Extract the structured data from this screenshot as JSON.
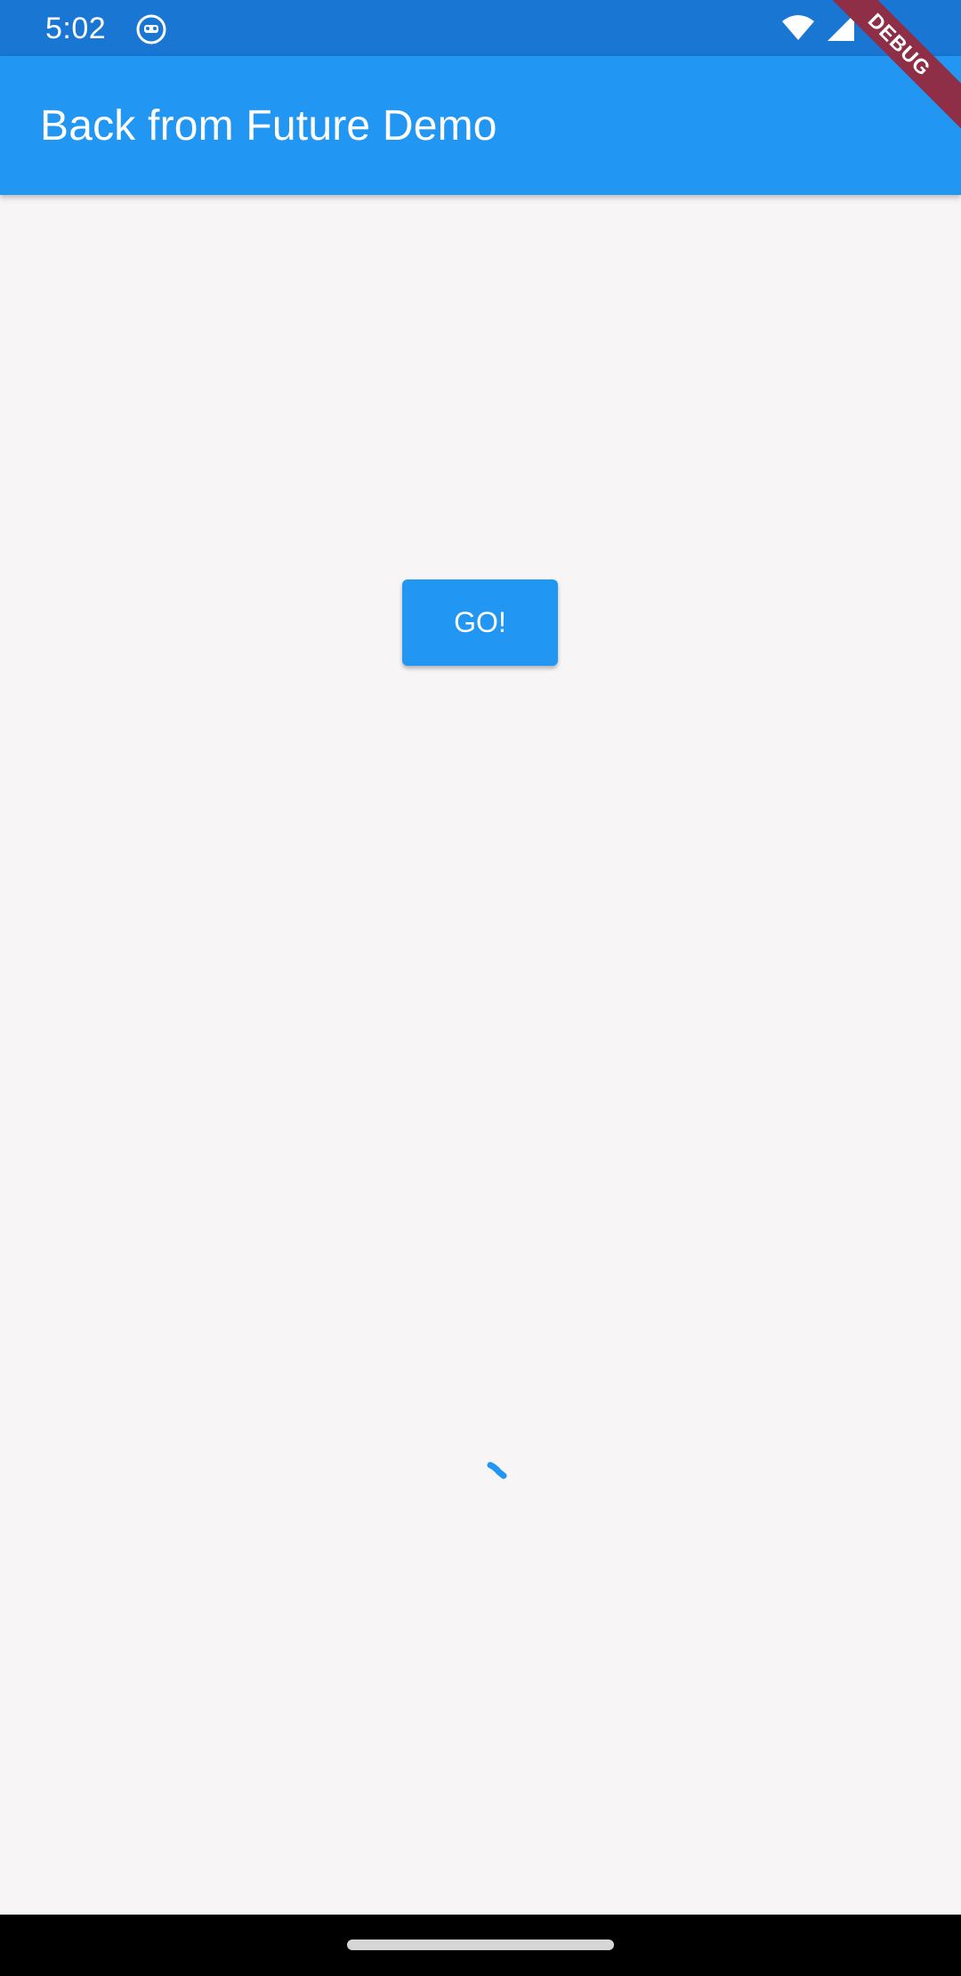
{
  "status_bar": {
    "time": "5:02",
    "icons": [
      "app-notification-icon",
      "wifi-icon",
      "cell-signal-icon"
    ]
  },
  "debug_banner": {
    "label": "DEBUG"
  },
  "app_bar": {
    "title": "Back from Future Demo"
  },
  "main": {
    "go_button_label": "GO!",
    "loading_indicator": "spinner-icon"
  },
  "colors": {
    "status_bar": "#1976d2",
    "app_bar": "#2196f3",
    "button": "#2196f3",
    "background": "#f7f5f6",
    "debug_banner": "#8e2f47"
  }
}
